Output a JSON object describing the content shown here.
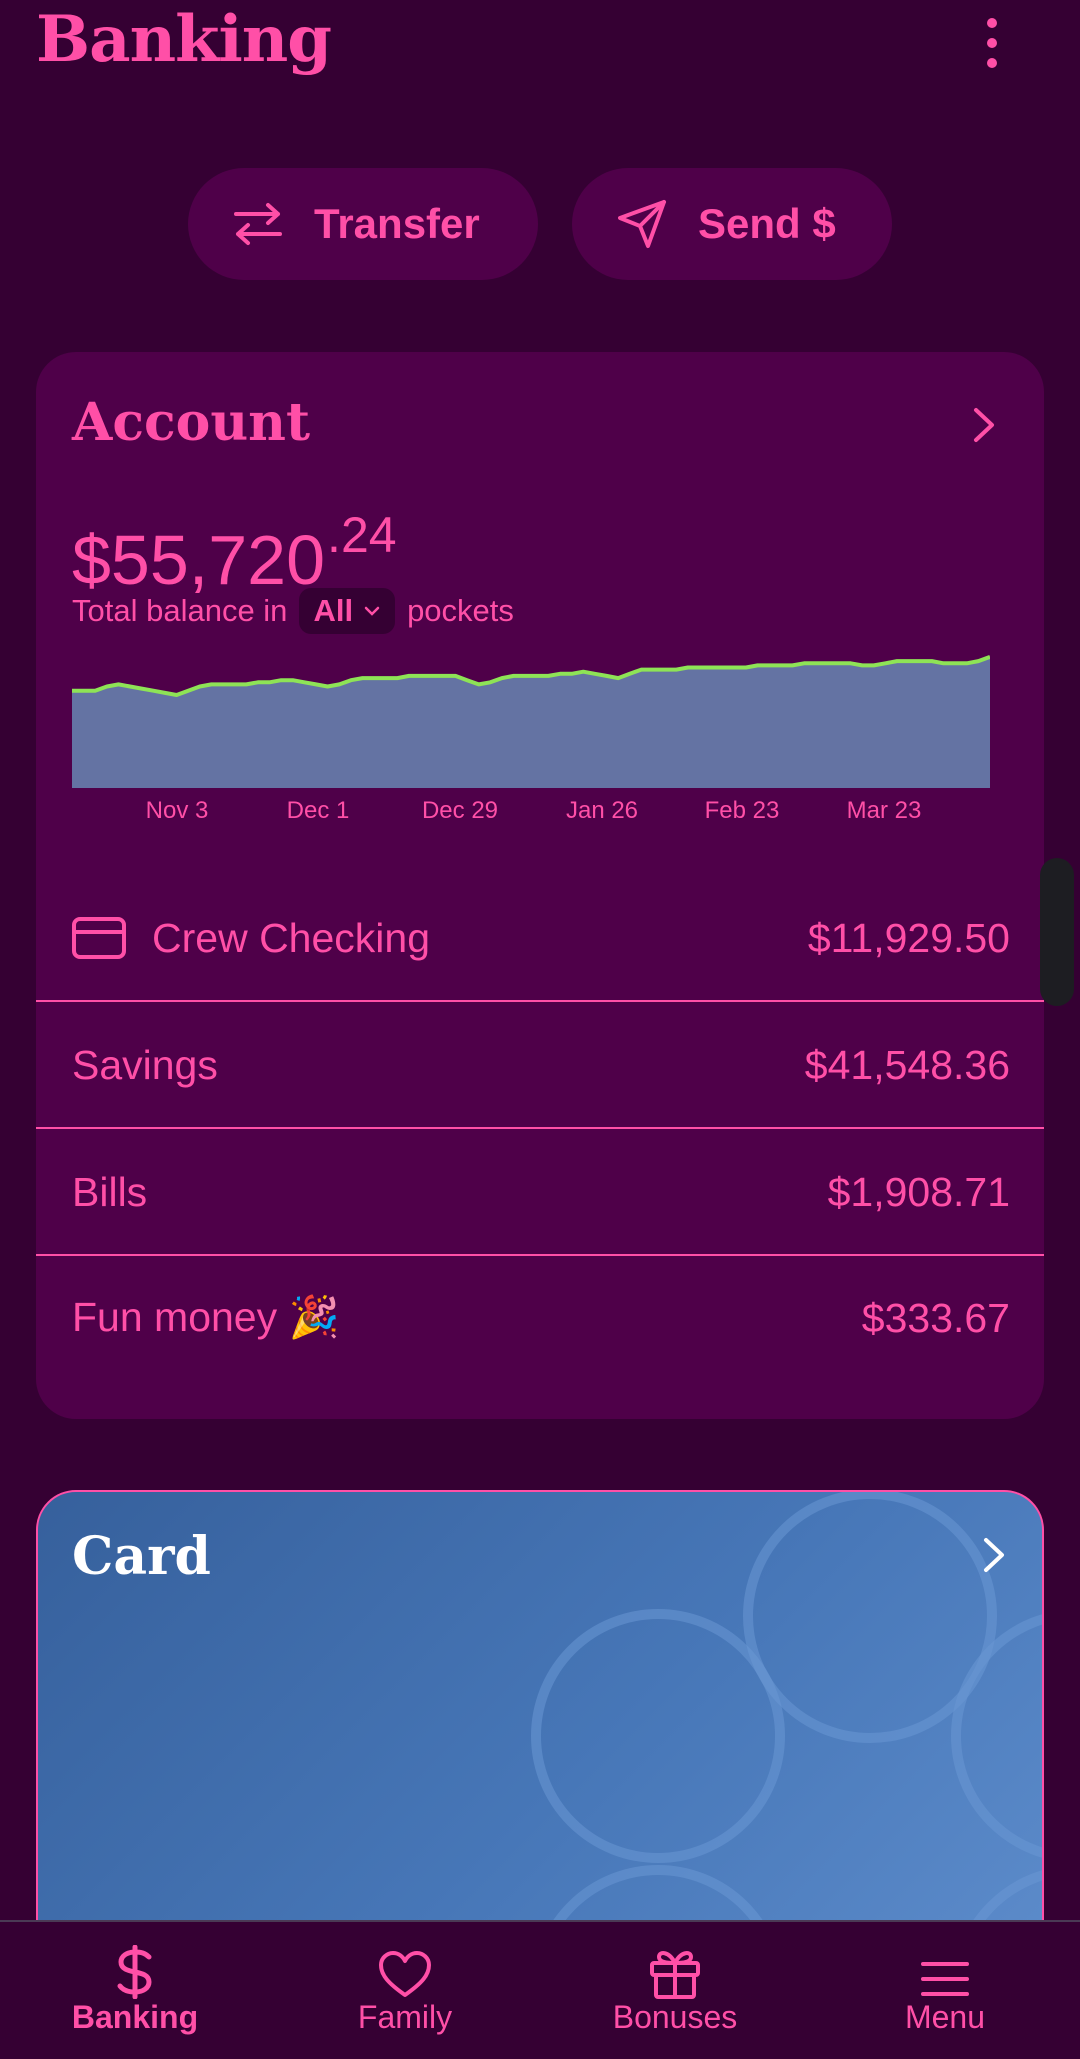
{
  "header": {
    "title": "Banking",
    "more_icon": "more-vertical-icon"
  },
  "actions": {
    "transfer_label": "Transfer",
    "transfer_icon": "transfer-arrows-icon",
    "send_label": "Send $",
    "send_icon": "paper-plane-icon"
  },
  "account": {
    "title": "Account",
    "balance_main": "$55,720",
    "balance_cents": ".24",
    "subtitle_prefix": "Total balance in",
    "pocket_filter": "All",
    "subtitle_suffix": "pockets",
    "accounts": [
      {
        "name": "Crew Checking",
        "amount": "$11,929.50",
        "icon": "credit-card-icon"
      },
      {
        "name": "Savings",
        "amount": "$41,548.36"
      },
      {
        "name": "Bills",
        "amount": "$1,908.71"
      },
      {
        "name": "Fun money 🎉",
        "amount": "$333.67"
      }
    ]
  },
  "chart_data": {
    "type": "area",
    "x_ticks": [
      "Nov 3",
      "Dec 1",
      "Dec 29",
      "Jan 26",
      "Feb 23",
      "Mar 23"
    ],
    "values": [
      46,
      46,
      46,
      48,
      49,
      48,
      47,
      46,
      45,
      44,
      46,
      48,
      49,
      49,
      49,
      49,
      50,
      50,
      51,
      51,
      50,
      49,
      48,
      49,
      51,
      52,
      52,
      52,
      52,
      53,
      53,
      53,
      53,
      53,
      51,
      49,
      50,
      52,
      53,
      53,
      53,
      53,
      54,
      54,
      55,
      54,
      53,
      52,
      54,
      56,
      56,
      56,
      56,
      57,
      57,
      57,
      57,
      57,
      57,
      58,
      58,
      58,
      58,
      59,
      59,
      59,
      59,
      59,
      58,
      58,
      59,
      60,
      60,
      60,
      60,
      59,
      59,
      59,
      60,
      62
    ],
    "line_color": "#8ee356",
    "fill_color": "#6473a3"
  },
  "card": {
    "title": "Card"
  },
  "nav": [
    {
      "label": "Banking",
      "icon": "dollar-icon",
      "active": true
    },
    {
      "label": "Family",
      "icon": "heart-icon",
      "active": false
    },
    {
      "label": "Bonuses",
      "icon": "gift-icon",
      "active": false
    },
    {
      "label": "Menu",
      "icon": "hamburger-menu-icon",
      "active": false
    }
  ],
  "colors": {
    "background": "#350033",
    "surface": "#4f0049",
    "accent": "#ff4fa7",
    "card_blue": "#4777b8"
  }
}
